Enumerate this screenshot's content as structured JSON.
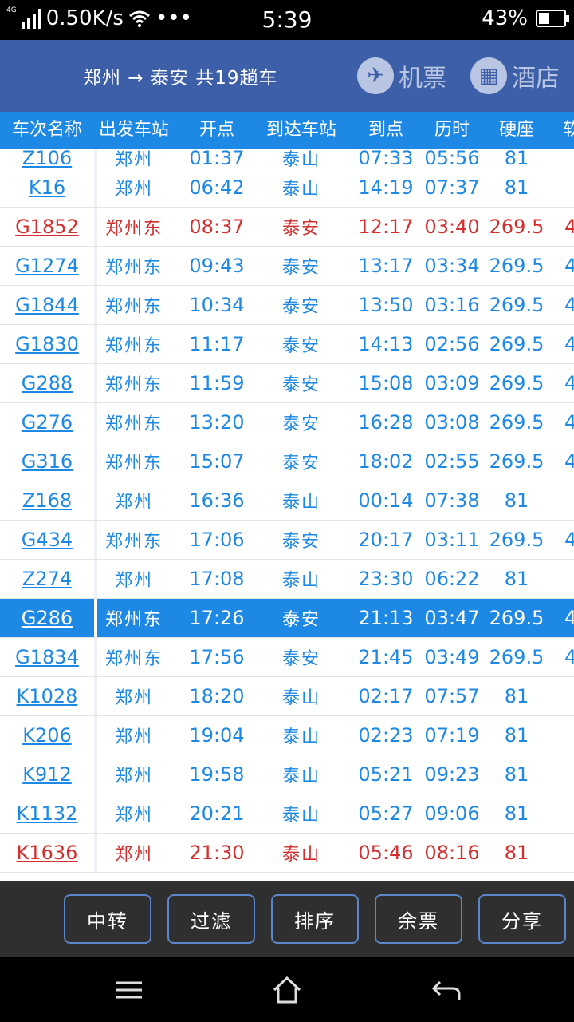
{
  "status": {
    "network": "4G",
    "speed": "0.50K/s",
    "dots": "•••",
    "time": "5:39",
    "battery": "43%",
    "battery_level": 0.43
  },
  "header": {
    "route": "郑州 → 泰安 共19趟车",
    "flight_label": "机票",
    "hotel_label": "酒店"
  },
  "columns": [
    "车次名称",
    "出发车站",
    "开点",
    "到达车站",
    "到点",
    "历时",
    "硬座",
    "软"
  ],
  "rows": [
    {
      "train": "Z106",
      "from": "郑州",
      "dep": "01:37",
      "to": "泰山",
      "arr": "07:33",
      "dur": "05:56",
      "seat": "81",
      "soft": "",
      "style": ""
    },
    {
      "train": "K16",
      "from": "郑州",
      "dep": "06:42",
      "to": "泰山",
      "arr": "14:19",
      "dur": "07:37",
      "seat": "81",
      "soft": "",
      "style": ""
    },
    {
      "train": "G1852",
      "from": "郑州东",
      "dep": "08:37",
      "to": "泰安",
      "arr": "12:17",
      "dur": "03:40",
      "seat": "269.5",
      "soft": "4",
      "style": "red"
    },
    {
      "train": "G1274",
      "from": "郑州东",
      "dep": "09:43",
      "to": "泰安",
      "arr": "13:17",
      "dur": "03:34",
      "seat": "269.5",
      "soft": "4",
      "style": ""
    },
    {
      "train": "G1844",
      "from": "郑州东",
      "dep": "10:34",
      "to": "泰安",
      "arr": "13:50",
      "dur": "03:16",
      "seat": "269.5",
      "soft": "4",
      "style": ""
    },
    {
      "train": "G1830",
      "from": "郑州东",
      "dep": "11:17",
      "to": "泰安",
      "arr": "14:13",
      "dur": "02:56",
      "seat": "269.5",
      "soft": "4",
      "style": ""
    },
    {
      "train": "G288",
      "from": "郑州东",
      "dep": "11:59",
      "to": "泰安",
      "arr": "15:08",
      "dur": "03:09",
      "seat": "269.5",
      "soft": "4",
      "style": ""
    },
    {
      "train": "G276",
      "from": "郑州东",
      "dep": "13:20",
      "to": "泰安",
      "arr": "16:28",
      "dur": "03:08",
      "seat": "269.5",
      "soft": "4",
      "style": ""
    },
    {
      "train": "G316",
      "from": "郑州东",
      "dep": "15:07",
      "to": "泰安",
      "arr": "18:02",
      "dur": "02:55",
      "seat": "269.5",
      "soft": "4",
      "style": ""
    },
    {
      "train": "Z168",
      "from": "郑州",
      "dep": "16:36",
      "to": "泰山",
      "arr": "00:14",
      "dur": "07:38",
      "seat": "81",
      "soft": "",
      "style": ""
    },
    {
      "train": "G434",
      "from": "郑州东",
      "dep": "17:06",
      "to": "泰安",
      "arr": "20:17",
      "dur": "03:11",
      "seat": "269.5",
      "soft": "4",
      "style": ""
    },
    {
      "train": "Z274",
      "from": "郑州",
      "dep": "17:08",
      "to": "泰山",
      "arr": "23:30",
      "dur": "06:22",
      "seat": "81",
      "soft": "",
      "style": ""
    },
    {
      "train": "G286",
      "from": "郑州东",
      "dep": "17:26",
      "to": "泰安",
      "arr": "21:13",
      "dur": "03:47",
      "seat": "269.5",
      "soft": "4",
      "style": "hl"
    },
    {
      "train": "G1834",
      "from": "郑州东",
      "dep": "17:56",
      "to": "泰安",
      "arr": "21:45",
      "dur": "03:49",
      "seat": "269.5",
      "soft": "4",
      "style": ""
    },
    {
      "train": "K1028",
      "from": "郑州",
      "dep": "18:20",
      "to": "泰山",
      "arr": "02:17",
      "dur": "07:57",
      "seat": "81",
      "soft": "",
      "style": ""
    },
    {
      "train": "K206",
      "from": "郑州",
      "dep": "19:04",
      "to": "泰山",
      "arr": "02:23",
      "dur": "07:19",
      "seat": "81",
      "soft": "",
      "style": ""
    },
    {
      "train": "K912",
      "from": "郑州",
      "dep": "19:58",
      "to": "泰山",
      "arr": "05:21",
      "dur": "09:23",
      "seat": "81",
      "soft": "",
      "style": ""
    },
    {
      "train": "K1132",
      "from": "郑州",
      "dep": "20:21",
      "to": "泰山",
      "arr": "05:27",
      "dur": "09:06",
      "seat": "81",
      "soft": "",
      "style": ""
    },
    {
      "train": "K1636",
      "from": "郑州",
      "dep": "21:30",
      "to": "泰山",
      "arr": "05:46",
      "dur": "08:16",
      "seat": "81",
      "soft": "",
      "style": "red"
    }
  ],
  "toolbar": {
    "transfer": "中转",
    "filter": "过滤",
    "sort": "排序",
    "tickets": "余票",
    "share": "分享"
  },
  "colors": {
    "title_bg": "#3d5fa8",
    "header_bg": "#1e88e5",
    "link": "#1e88e5",
    "highlight_text": "#d32f2f"
  }
}
